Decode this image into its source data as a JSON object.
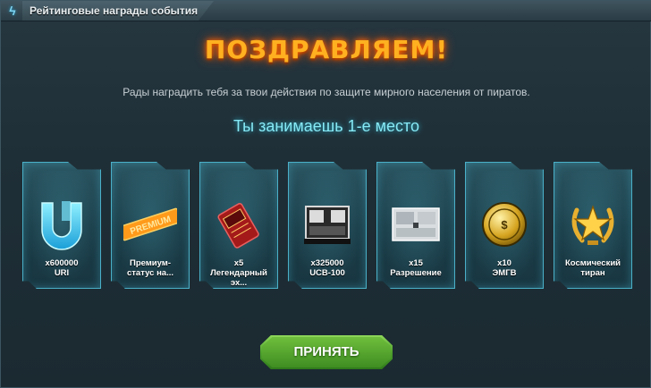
{
  "window": {
    "title": "Рейтинговые награды события",
    "title_icon": "lightning-icon"
  },
  "main": {
    "headline": "ПОЗДРАВЛЯЕМ!",
    "description": "Рады наградить тебя за твои действия по защите мирного населения от пиратов.",
    "rank_text": "Ты занимаешь 1-е место"
  },
  "rewards": [
    {
      "line1": "x600000",
      "line2": "URI",
      "line3": "",
      "icon": "uri-currency-icon"
    },
    {
      "line1": "Премиум-",
      "line2": "статус на...",
      "line3": "",
      "icon": "premium-badge-icon"
    },
    {
      "line1": "x5",
      "line2": "Легендарный",
      "line3": "эх...",
      "icon": "legendary-crate-icon"
    },
    {
      "line1": "x325000",
      "line2": "UCB-100",
      "line3": "",
      "icon": "ammo-box-icon"
    },
    {
      "line1": "x15",
      "line2": "Разрешение",
      "line3": "",
      "icon": "permit-document-icon"
    },
    {
      "line1": "x10",
      "line2": "ЭМГВ",
      "line3": "",
      "icon": "gold-coin-icon"
    },
    {
      "line1": "Космический",
      "line2": "тиран",
      "line3": "",
      "icon": "star-laurel-icon"
    }
  ],
  "actions": {
    "accept_label": "ПРИНЯТЬ"
  },
  "colors": {
    "headline": "#ffb020",
    "rank": "#86e9f5",
    "accept": "#4fa22d"
  }
}
